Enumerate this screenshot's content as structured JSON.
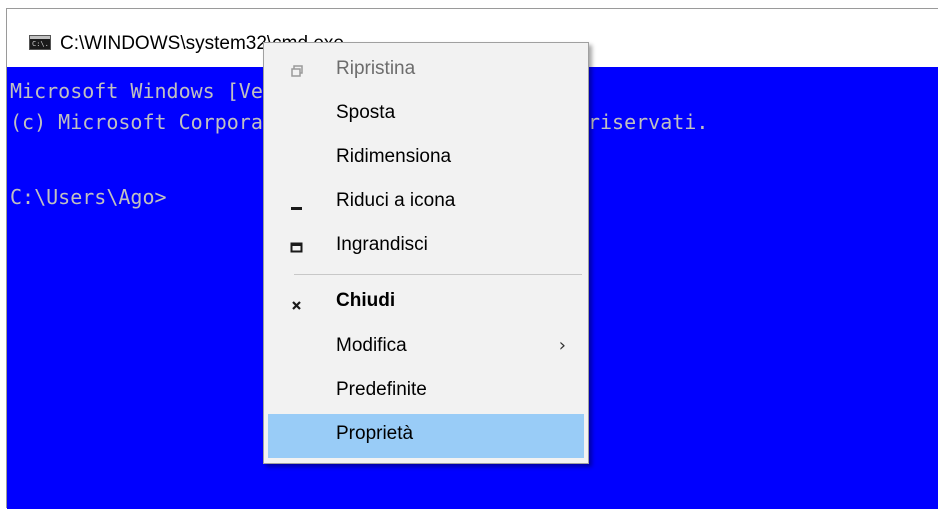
{
  "window": {
    "title": "C:\\WINDOWS\\system32\\cmd.exe",
    "icon": "cmd-icon",
    "icon_text": "C:\\."
  },
  "console": {
    "background": "#0000ff",
    "lines": [
      "Microsoft Windows [Versione 10.0.17134.1466]",
      "(c) Microsoft Corporation. Tutti i diritti sono riservati.",
      "",
      "C:\\Users\\Ago>"
    ]
  },
  "context_menu": {
    "items": [
      {
        "label": "Ripristina",
        "icon": "restore-icon",
        "disabled": true
      },
      {
        "label": "Sposta"
      },
      {
        "label": "Ridimensiona"
      },
      {
        "label": "Riduci a icona",
        "icon": "minimize-icon"
      },
      {
        "label": "Ingrandisci",
        "icon": "maximize-icon"
      },
      {
        "label": "Chiudi",
        "icon": "close-icon",
        "bold": true
      },
      {
        "label": "Modifica",
        "submenu_arrow": "›"
      },
      {
        "label": "Predefinite"
      },
      {
        "label": "Proprietà",
        "highlighted": true
      }
    ],
    "highlight_color": "#99ccf7"
  }
}
